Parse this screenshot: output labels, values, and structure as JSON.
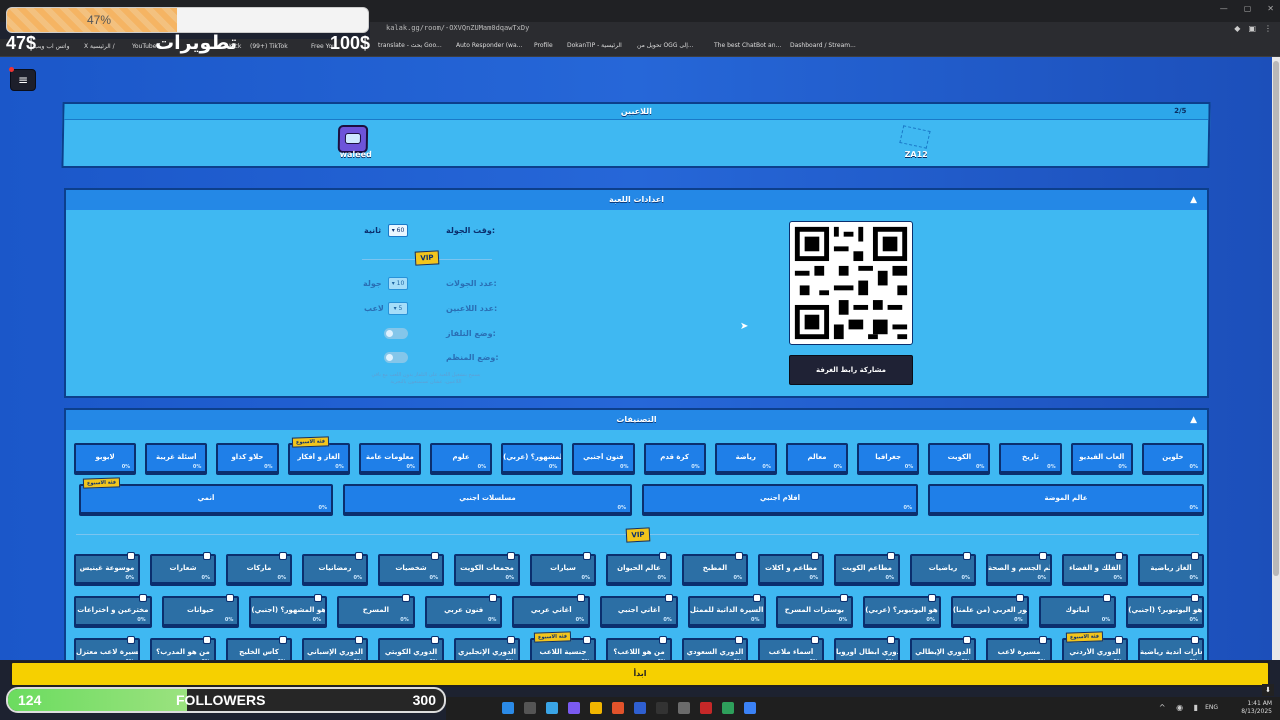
{
  "overlay": {
    "progress_pct": 47,
    "progress_label": "47%",
    "money_left": "47$",
    "money_mid": "100$",
    "channel_title": "تطويرات",
    "links": [
      "واتس اب ويب",
      "X الرئيسية /",
      "YouTube",
      "Kick",
      "(99+) TikTok",
      "Free You"
    ]
  },
  "browser": {
    "url": "kalak.gg/room/-OXVQnZUMam0dqawTxDy",
    "bookmarks": [
      "translate - بحث Goo...",
      "Auto Responder (wa...",
      "Profile",
      "DokanTIP - الرئيسية",
      "تحويل من OGG إلى...",
      "The best ChatBot an...",
      "Dashboard / Stream..."
    ]
  },
  "players": {
    "title": "اللاعبين",
    "count": "2/5",
    "player1": "waleed",
    "player2": "ZA12"
  },
  "settings": {
    "title": "اعدادات اللعبة",
    "round_time_label": "وقت الجولة:",
    "round_time_value": "60",
    "round_time_unit": "ثانية",
    "vip": "VIP",
    "rounds_label": "عدد الجولات:",
    "rounds_value": "10",
    "rounds_unit": "جولة",
    "players_label": "عدد اللاعبين:",
    "players_value": "5",
    "players_unit": "لاعب",
    "tv_mode_label": "وضع التلفاز:",
    "organizer_mode_label": "وضع المنظم:",
    "note": "يسمح بتشغيل اللعبة على التلفاز بدون اللعب مع باقي اللاعبين، عشان تستمتعون بالتجربة",
    "share_button": "مشاركة رابط الغرفة"
  },
  "categories": {
    "title": "التصنيفات",
    "vip": "VIP",
    "new_tag": "فئة الاسبوع",
    "row1": [
      {
        "label": "خلوين",
        "pct": "0%"
      },
      {
        "label": "ألعاب الفيديو",
        "pct": "0%"
      },
      {
        "label": "تاريخ",
        "pct": "0%"
      },
      {
        "label": "الكويت",
        "pct": "0%"
      },
      {
        "label": "جغرافيا",
        "pct": "0%"
      },
      {
        "label": "معالم",
        "pct": "0%"
      },
      {
        "label": "رياضة",
        "pct": "0%"
      },
      {
        "label": "كرة قدم",
        "pct": "0%"
      },
      {
        "label": "فنون أجنبي",
        "pct": "0%"
      },
      {
        "label": "من هو المشهور؟ (عربي)",
        "pct": "0%"
      },
      {
        "label": "علوم",
        "pct": "0%"
      },
      {
        "label": "معلومات عامة",
        "pct": "0%"
      },
      {
        "label": "ألغاز و أفكار",
        "pct": "0%"
      },
      {
        "label": "حلاو كذاو",
        "pct": "0%"
      },
      {
        "label": "أسئلة غريبة",
        "pct": "0%"
      },
      {
        "label": "لابوبو",
        "pct": "0%"
      }
    ],
    "row2": [
      {
        "label": "عالم الموضة",
        "pct": "0%"
      },
      {
        "label": "أفلام أجنبي",
        "pct": "0%"
      },
      {
        "label": "مسلسلات أجنبي",
        "pct": "0%"
      },
      {
        "label": "أنمي",
        "pct": "0%"
      }
    ],
    "row3": [
      {
        "label": "ألغاز رياضية",
        "pct": "0%"
      },
      {
        "label": "الفلك و الفضاء",
        "pct": "0%"
      },
      {
        "label": "علم الجسم و الصحة",
        "pct": "0%"
      },
      {
        "label": "رياضيات",
        "pct": "0%"
      },
      {
        "label": "مطاعم الكويت",
        "pct": "0%"
      },
      {
        "label": "مطاعم و أكلات",
        "pct": "0%"
      },
      {
        "label": "المطبخ",
        "pct": "0%"
      },
      {
        "label": "عالم الحيوان",
        "pct": "0%"
      },
      {
        "label": "سيارات",
        "pct": "0%"
      },
      {
        "label": "مجمعات الكويت",
        "pct": "0%"
      },
      {
        "label": "شخصيات",
        "pct": "0%"
      },
      {
        "label": "رمضانيات",
        "pct": "0%"
      },
      {
        "label": "ماركات",
        "pct": "0%"
      },
      {
        "label": "شعارات",
        "pct": "0%"
      },
      {
        "label": "موسوعة غينيس",
        "pct": "0%"
      }
    ],
    "row4": [
      {
        "label": "من هو اليوتيوبر؟ (أجنبي)",
        "pct": "0%"
      },
      {
        "label": "أيباتوك",
        "pct": "0%"
      },
      {
        "label": "من هو المشهور العربي (من علمنا)",
        "pct": "0%"
      },
      {
        "label": "من هو اليوتيوبر؟ (عربي)",
        "pct": "0%"
      },
      {
        "label": "بوسترات المسرح",
        "pct": "0%"
      },
      {
        "label": "السيرة الذاتية للممثل",
        "pct": "0%"
      },
      {
        "label": "أغاني أجنبي",
        "pct": "0%"
      },
      {
        "label": "أغاني عربي",
        "pct": "0%"
      },
      {
        "label": "فنون عربي",
        "pct": "0%"
      },
      {
        "label": "المسرح",
        "pct": "0%"
      },
      {
        "label": "من هو المشهور؟ (أجنبي)",
        "pct": "0%"
      },
      {
        "label": "حيوانات",
        "pct": "0%"
      },
      {
        "label": "مخترعين و اختراعات",
        "pct": "0%"
      }
    ],
    "row5": [
      {
        "label": "شعارات أندية رياضية",
        "pct": "0%"
      },
      {
        "label": "الدوري الأردني",
        "pct": "0%"
      },
      {
        "label": "مسيرة لاعب",
        "pct": "0%"
      },
      {
        "label": "الدوري الإيطالي",
        "pct": "0%"
      },
      {
        "label": "دوري أبطال أوروبا",
        "pct": "0%"
      },
      {
        "label": "أسماء ملاعب",
        "pct": "0%"
      },
      {
        "label": "الدوري السعودي",
        "pct": "0%"
      },
      {
        "label": "من هو اللاعب؟",
        "pct": "0%"
      },
      {
        "label": "جنسية اللاعب",
        "pct": "0%"
      },
      {
        "label": "الدوري الإنجليزي",
        "pct": "0%"
      },
      {
        "label": "الدوري الكويتي",
        "pct": "0%"
      },
      {
        "label": "الدوري الإسباني",
        "pct": "0%"
      },
      {
        "label": "كأس الخليج",
        "pct": "0%"
      },
      {
        "label": "من هو المدرب؟",
        "pct": "0%"
      },
      {
        "label": "مسيرة لاعب معتزل",
        "pct": "0%"
      }
    ]
  },
  "footer": {
    "bar_text": "ابدأ"
  },
  "followers": {
    "current": "124",
    "label": "FOLLOWERS",
    "goal": "300",
    "progress_pct": 41
  },
  "taskbar": {
    "lang": "ENG",
    "time": "1:41 AM",
    "date": "8/13/2025"
  }
}
